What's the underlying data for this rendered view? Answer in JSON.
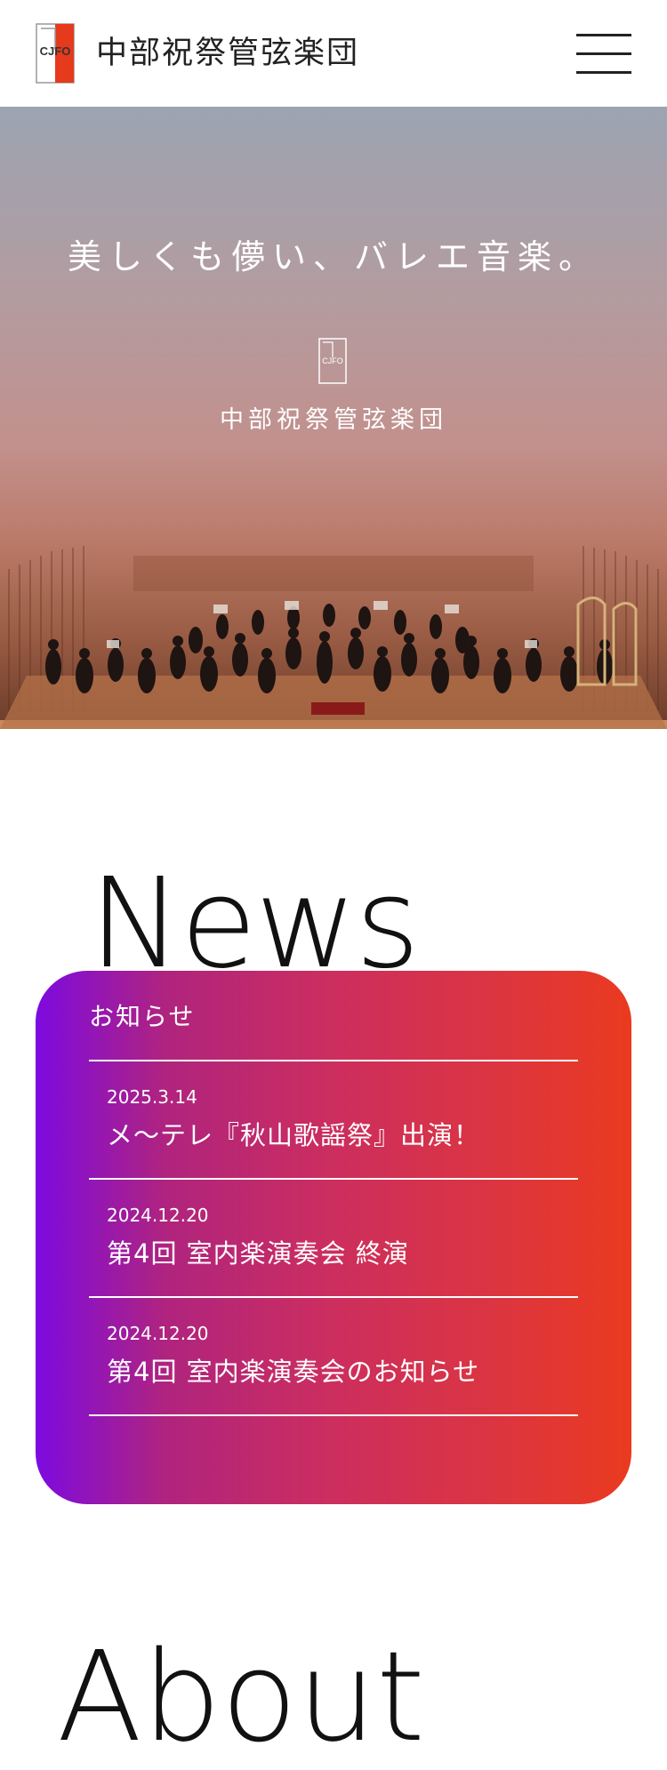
{
  "header": {
    "logo_text": "CJFO",
    "site_title": "中部祝祭管弦楽団"
  },
  "hero": {
    "tagline": "美しくも儚い、バレエ音楽。",
    "logo_text": "CJFO",
    "org_name": "中部祝祭管弦楽団"
  },
  "news": {
    "heading": "News",
    "label": "お知らせ",
    "items": [
      {
        "date": "2025.3.14",
        "title": "メ～テレ『秋山歌謡祭』出演！"
      },
      {
        "date": "2024.12.20",
        "title": "第4回 室内楽演奏会 終演"
      },
      {
        "date": "2024.12.20",
        "title": "第4回 室内楽演奏会のお知らせ"
      }
    ]
  },
  "about": {
    "heading": "About"
  },
  "colors": {
    "logo_red": "#e63a1d",
    "card_gradient_start": "#7d0ae0",
    "card_gradient_end": "#ea3a1f"
  }
}
